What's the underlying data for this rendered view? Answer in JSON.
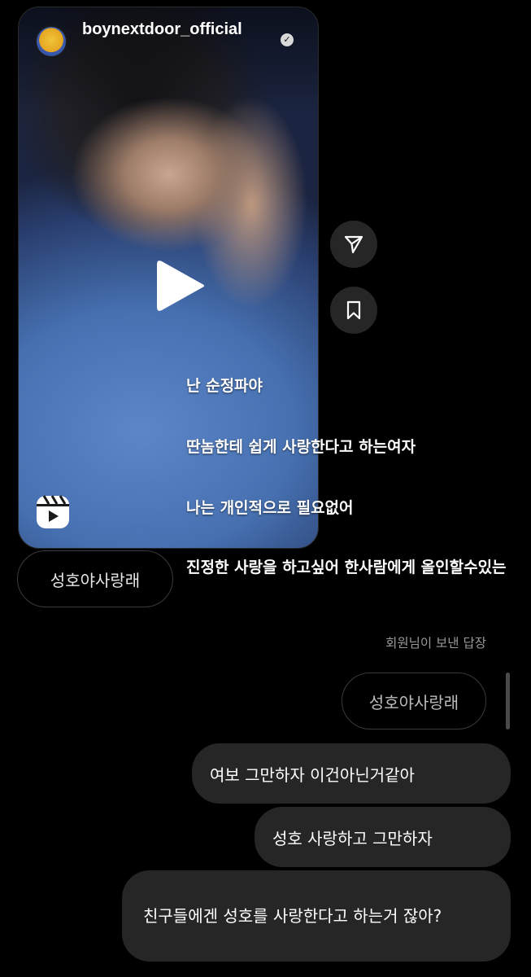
{
  "reel": {
    "account_name": "boynextdoor_official",
    "verified_icon": "verified-badge-icon",
    "play_icon": "play-icon",
    "reels_icon": "reels-icon"
  },
  "actions": {
    "share_icon": "paper-plane-icon",
    "save_icon": "bookmark-icon"
  },
  "captions": [
    "난 순정파야",
    "딴놈한테 쉽게 사랑한다고 하는여자",
    "나는 개인적으로 필요없어",
    "진정한 사랑을 하고싶어 한사람에게 올인할수있는"
  ],
  "chip_left": "성호야사랑래",
  "reply_label": "회원님이 보낸 답장",
  "chip_right": "성호야사랑래",
  "messages": [
    "여보 그만하자 이건아닌거같아",
    "성호 사랑하고 그만하자",
    "친구들에겐 성호를 사랑한다고 하는거 잖아?"
  ],
  "colors": {
    "background": "#000000",
    "bubble": "#262626",
    "secondary_text": "#9a9a9a"
  }
}
